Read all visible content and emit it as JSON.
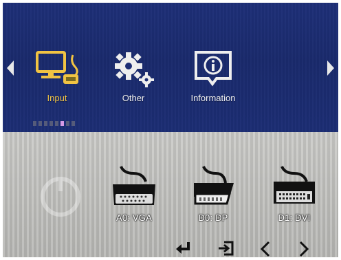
{
  "nav": {
    "left_arrow_icon": "chevron-left-icon",
    "right_arrow_icon": "chevron-right-icon"
  },
  "menu": {
    "items": [
      {
        "label": "Input",
        "icon": "monitor-input-icon",
        "active": true
      },
      {
        "label": "Other",
        "icon": "gear-icon",
        "active": false
      },
      {
        "label": "Information",
        "icon": "info-icon",
        "active": false
      }
    ],
    "accent_color": "#f1c343",
    "page_indicator": {
      "count": 8,
      "active_index": 5
    }
  },
  "sources": [
    {
      "label": "A0: VGA",
      "icon": "vga-connector-icon"
    },
    {
      "label": "D0: DP",
      "icon": "displayport-connector-icon"
    },
    {
      "label": "D1: DVI",
      "icon": "dvi-connector-icon"
    }
  ],
  "bottom_controls": [
    {
      "icon": "enter-icon"
    },
    {
      "icon": "exit-icon"
    },
    {
      "icon": "chevron-left-icon"
    },
    {
      "icon": "chevron-right-icon"
    }
  ]
}
